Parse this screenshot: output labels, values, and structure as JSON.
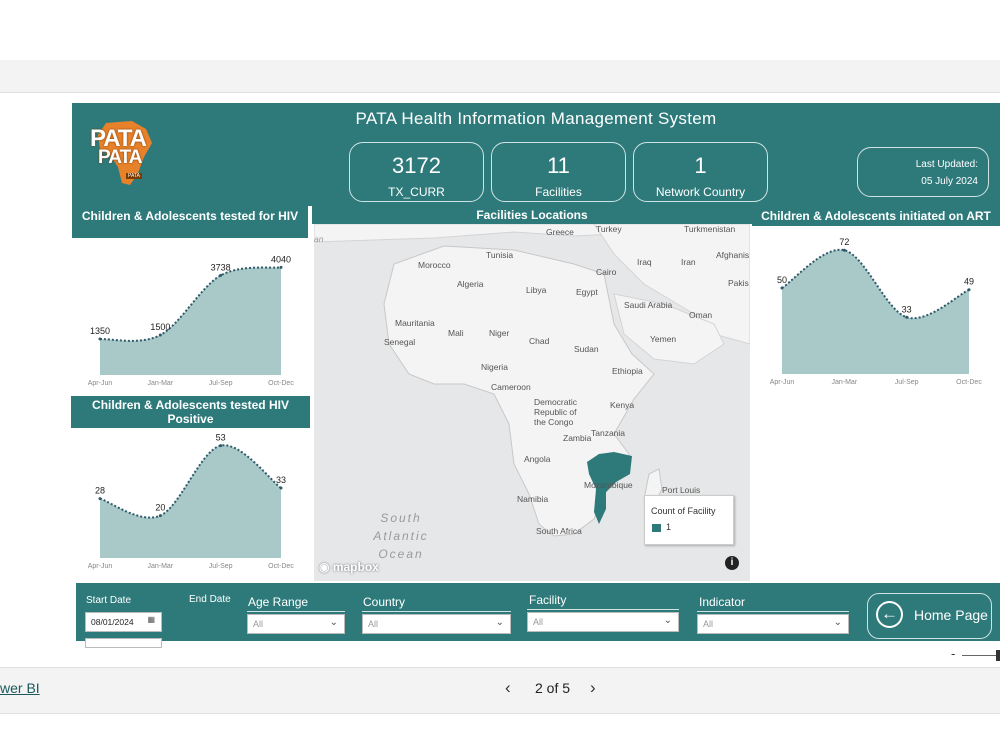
{
  "header": {
    "title": "PATA Health Information  Management System",
    "logo_line1": "PATA",
    "logo_line2": "PATA",
    "logo_tag": "PATA",
    "kpis": [
      {
        "value": "3172",
        "label": "TX_CURR"
      },
      {
        "value": "11",
        "label": "Facilities"
      },
      {
        "value": "1",
        "label": "Network Country"
      }
    ],
    "last_updated_label": "Last Updated:",
    "last_updated_value": "05 July 2024"
  },
  "panels": {
    "tested_title": "Children & Adolescents tested for HIV",
    "positive_title": "Children & Adolescents tested HIV Positive",
    "map_title": "Facilities Locations",
    "art_title": "Children & Adolescents initiated on ART"
  },
  "chart_data": [
    {
      "type": "area",
      "title": "Children & Adolescents tested for HIV",
      "categories": [
        "Apr-Jun",
        "Jan-Mar",
        "Jul-Sep",
        "Oct-Dec"
      ],
      "values": [
        1350,
        1500,
        3738,
        4040
      ],
      "color": "#a9c9c9",
      "line_color": "#2e5a6a"
    },
    {
      "type": "area",
      "title": "Children & Adolescents tested HIV Positive",
      "categories": [
        "Apr-Jun",
        "Jan-Mar",
        "Jul-Sep",
        "Oct-Dec"
      ],
      "values": [
        28,
        20,
        53,
        33
      ],
      "color": "#a9c9c9",
      "line_color": "#2e5a6a"
    },
    {
      "type": "area",
      "title": "Children & Adolescents initiated on ART",
      "categories": [
        "Apr-Jun",
        "Jan-Mar",
        "Jul-Sep",
        "Oct-Dec"
      ],
      "values": [
        50,
        72,
        33,
        49
      ],
      "color": "#a9c9c9",
      "line_color": "#2e5a6a"
    }
  ],
  "map": {
    "labels": [
      "Greece",
      "Turkey",
      "Turkmenistan",
      "Tunisia",
      "Morocco",
      "Algeria",
      "Libya",
      "Egypt",
      "Cairo",
      "Iraq",
      "Iran",
      "Afghanis",
      "Pakis",
      "Mauritania",
      "Mali",
      "Niger",
      "Saudi Arabia",
      "Oman",
      "Senegal",
      "Chad",
      "Sudan",
      "Yemen",
      "Nigeria",
      "Ethiopia",
      "Cameroon",
      "Democratic Republic of the Congo",
      "Kenya",
      "Tanzania",
      "Angola",
      "Zambia",
      "Mozambique",
      "Namibia",
      "Port Louis",
      "South Africa",
      "South Atlantic Ocean",
      "an"
    ],
    "legend_title": "Count of Facility",
    "legend_item": "1",
    "attribution": "mapbox",
    "highlight_color": "#2e7a7b"
  },
  "filters": {
    "start_date_label": "Start Date",
    "start_date_value": "08/01/2024",
    "end_date_label": "End Date",
    "age_label": "Age Range",
    "age_value": "All",
    "country_label": "Country",
    "country_value": "All",
    "facility_label": "Facility",
    "facility_value": "All",
    "indicator_label": "Indicator",
    "indicator_value": "All",
    "home_label": "Home Page"
  },
  "footer": {
    "powerbi_link": "wer BI",
    "page_indicator": "2 of 5",
    "zoom_minus": "-"
  }
}
